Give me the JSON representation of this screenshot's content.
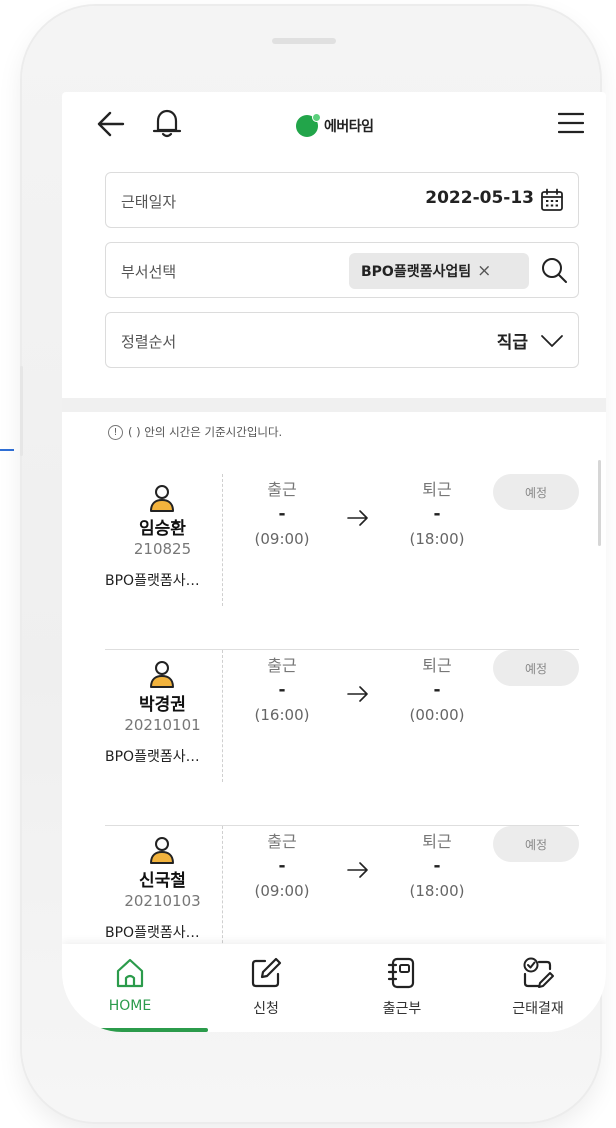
{
  "header": {
    "logo_text": "에버타임",
    "icons": [
      "back-arrow-icon",
      "bell-icon",
      "hamburger-menu-icon"
    ],
    "brand_color": "#22a54a"
  },
  "filters": {
    "date": {
      "label": "근태일자",
      "value": "2022-05-13"
    },
    "department": {
      "label": "부서선택",
      "value": "BPO플랫폼사업팀",
      "remove_glyph": "×"
    },
    "sort": {
      "label": "정렬순서",
      "value": "직급"
    }
  },
  "notice": {
    "icon_glyph": "!",
    "text": "( ) 안의 시간은 기준시간입니다."
  },
  "attendance": {
    "rows": [
      {
        "name": "임승환",
        "emp_id": "210825",
        "dept": "BPO플랫폼사…",
        "in_label": "출근",
        "in_value": "-",
        "in_time": "(09:00)",
        "out_label": "퇴근",
        "out_value": "-",
        "out_time": "(18:00)",
        "status": "예정"
      },
      {
        "name": "박경권",
        "emp_id": "20210101",
        "dept": "BPO플랫폼사…",
        "in_label": "출근",
        "in_value": "-",
        "in_time": "(16:00)",
        "out_label": "퇴근",
        "out_value": "-",
        "out_time": "(00:00)",
        "status": "예정"
      },
      {
        "name": "신국철",
        "emp_id": "20210103",
        "dept": "BPO플랫폼사…",
        "in_label": "출근",
        "in_value": "-",
        "in_time": "(09:00)",
        "out_label": "퇴근",
        "out_value": "-",
        "out_time": "(18:00)",
        "status": "예정"
      }
    ],
    "person_icon_color": "#f2b33d"
  },
  "bottom_nav": {
    "items": [
      {
        "label": "HOME",
        "icon": "home-icon",
        "active": true
      },
      {
        "label": "신청",
        "icon": "edit-icon",
        "active": false
      },
      {
        "label": "출근부",
        "icon": "notebook-icon",
        "active": false
      },
      {
        "label": "근태결재",
        "icon": "approval-icon",
        "active": false
      }
    ],
    "active_color": "#2b9b4b"
  }
}
